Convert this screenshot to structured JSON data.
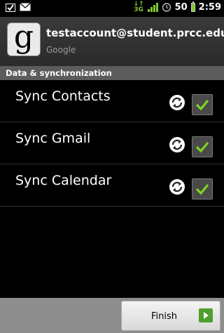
{
  "status_bar": {
    "network_label": "3G",
    "alarm_icon": "alarm-icon",
    "signal_label": "50",
    "time": "2:59"
  },
  "account": {
    "email": "testaccount@student.prcc.edu",
    "provider": "Google",
    "icon_letter": "g"
  },
  "section": {
    "title": "Data & synchronization"
  },
  "sync_items": [
    {
      "label": "Sync Contacts",
      "checked": true
    },
    {
      "label": "Sync Gmail",
      "checked": true
    },
    {
      "label": "Sync Calendar",
      "checked": true
    }
  ],
  "footer": {
    "finish_label": "Finish"
  },
  "colors": {
    "check_green": "#7dd321",
    "accent_green": "#4ea02e"
  }
}
